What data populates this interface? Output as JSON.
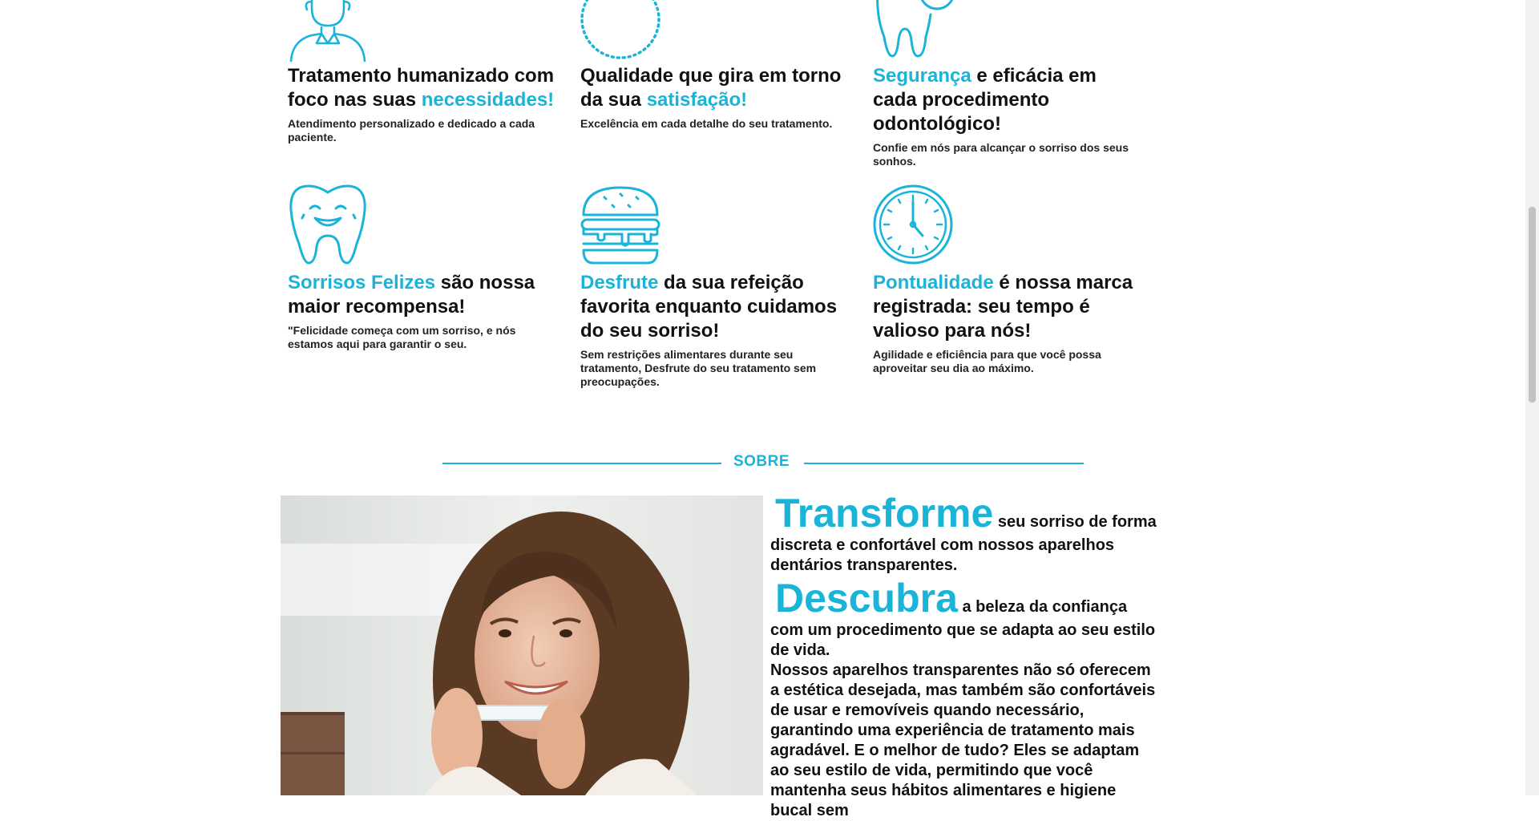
{
  "features": [
    {
      "pre": "Tratamento humanizado com foco nas suas ",
      "highlight": "necessidades!",
      "post": "",
      "desc": "Atendimento personalizado e dedicado a cada paciente.",
      "icon": "dentist-person-icon"
    },
    {
      "pre": "Qualidade que gira em torno da sua ",
      "highlight": "satisfação!",
      "post": "",
      "desc": "Excelência em cada detalhe do seu tratamento.",
      "icon": "dotted-circle-icon"
    },
    {
      "pre": "",
      "highlight": "Segurança",
      "post": " e eficácia em cada procedimento odontológico!",
      "desc": "Confie em nós para alcançar o sorriso dos seus sonhos.",
      "icon": "tooth-check-icon"
    },
    {
      "pre": "",
      "highlight": "Sorrisos Felizes",
      "post": " são nossa maior recompensa!",
      "desc": "\"Felicidade começa com um sorriso, e nós estamos aqui para garantir o seu.",
      "icon": "smiling-tooth-icon"
    },
    {
      "pre": "",
      "highlight": "Desfrute",
      "post": " da sua refeição favorita enquanto cuidamos do seu sorriso!",
      "desc": "Sem restrições alimentares durante seu tratamento, Desfrute do seu tratamento sem preocupações.",
      "icon": "burger-icon"
    },
    {
      "pre": "",
      "highlight": "Pontualidade",
      "post": " é nossa marca registrada: seu tempo é valioso para nós!",
      "desc": "Agilidade e eficiência para que você possa aproveitar seu dia ao máximo.",
      "icon": "clock-icon"
    }
  ],
  "sobre": {
    "label": "SOBRE"
  },
  "about": {
    "p1_big": "Transforme",
    "p1_rest": " seu sorriso de forma discreta e confortável com nossos aparelhos dentários transparentes.",
    "p2_big": "Descubra",
    "p2_rest": " a beleza da confiança com um procedimento que se adapta ao seu estilo de vida.",
    "p3": "Nossos aparelhos transparentes não só oferecem a estética desejada, mas também são confortáveis de usar e removíveis quando necessário, garantindo uma experiência de tratamento mais agradável. E o melhor de tudo? Eles se adaptam ao seu estilo de vida, permitindo que você mantenha seus hábitos alimentares e higiene bucal sem"
  },
  "colors": {
    "accent": "#19b4d8",
    "text": "#111111"
  }
}
